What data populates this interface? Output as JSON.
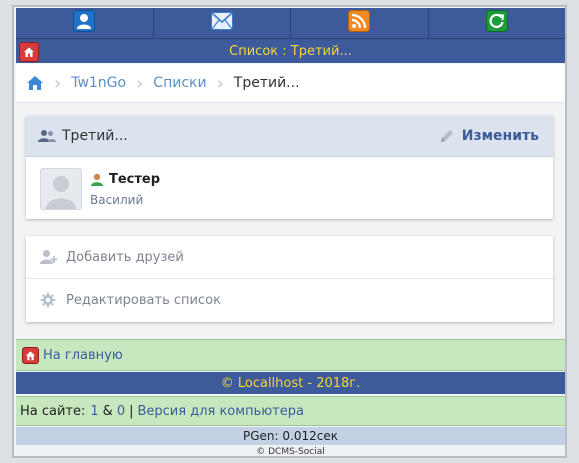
{
  "topnav": {
    "items": [
      {
        "icon": "user-icon",
        "color": "#1f72c6"
      },
      {
        "icon": "mail-icon",
        "color": "#3b7fd0"
      },
      {
        "icon": "rss-icon",
        "color": "#f08a24"
      },
      {
        "icon": "refresh-icon",
        "color": "#1e9b3d"
      }
    ]
  },
  "titlebar": {
    "title": "Список : Третий..."
  },
  "breadcrumb": {
    "items": [
      "Tw1nGo",
      "Списки",
      "Третий..."
    ]
  },
  "list_card": {
    "title": "Третий...",
    "edit_label": "Изменить",
    "member": {
      "name": "Тестер",
      "first_name": "Василий"
    }
  },
  "actions": {
    "add_friends": "Добавить друзей",
    "edit_list": "Редактировать список"
  },
  "footer": {
    "home_link": "На главную",
    "copyright": "© Locallhost - 2018г.",
    "online_label": "На сайте:",
    "online_a": "1",
    "online_amp": "&",
    "online_b": "0",
    "pipe": "|",
    "desktop_link": "Версия для компьютера",
    "pgen": "PGen: 0.012сек",
    "dcms": "© DCMS-Social"
  },
  "colors": {
    "header_blue": "#3d5a9b",
    "title_yellow": "#f7d63b",
    "green_bar": "#c7e8bf",
    "link_blue": "#3d5a9b"
  }
}
